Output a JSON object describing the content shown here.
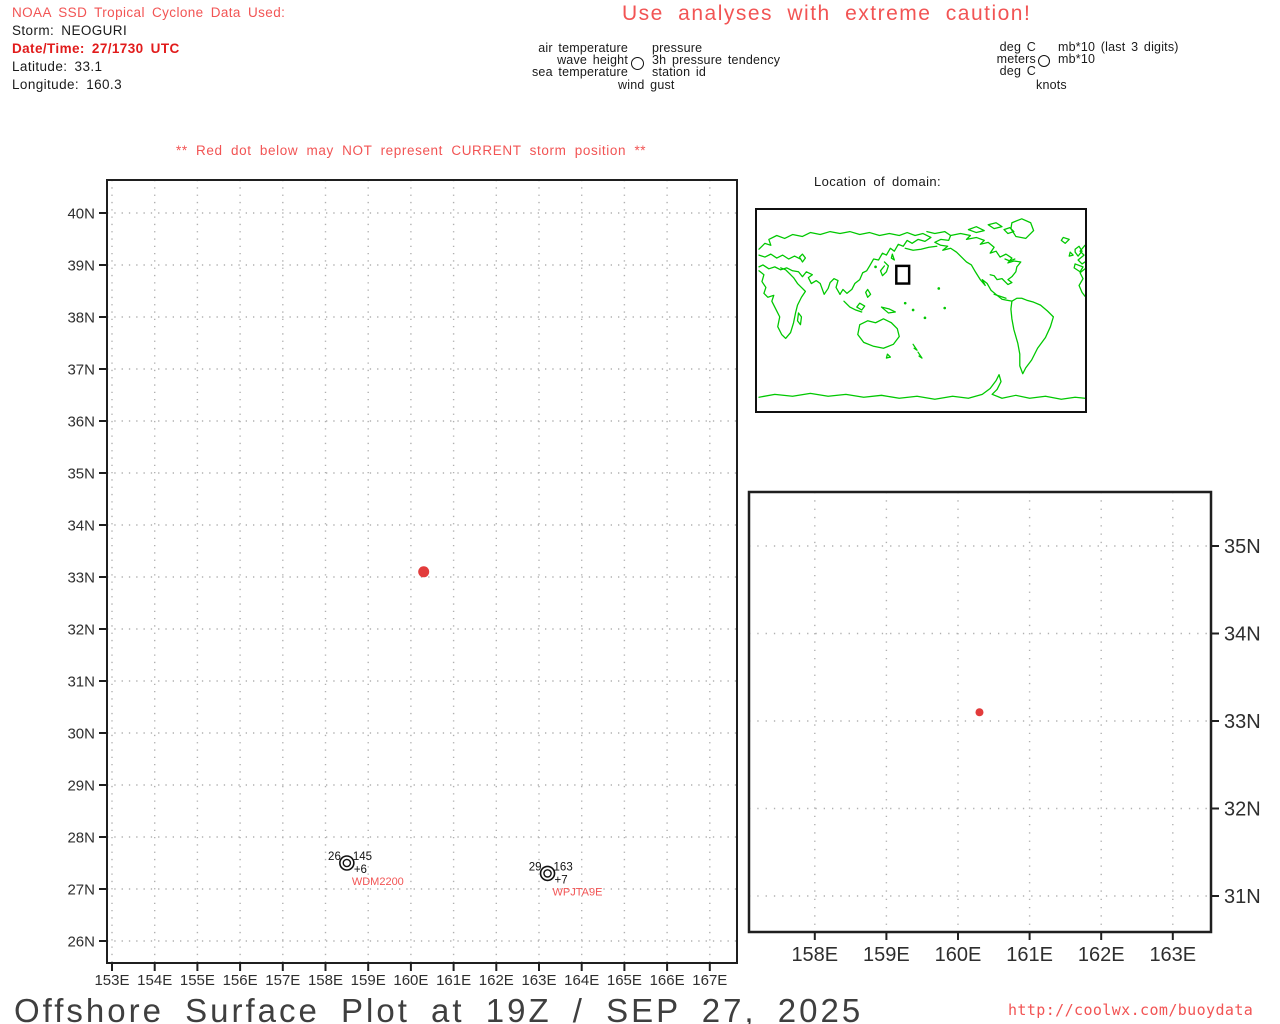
{
  "header": {
    "source_line": "NOAA SSD Tropical Cyclone Data Used:",
    "storm_line": "Storm: NEOGURI",
    "datetime_line": "Date/Time: 27/1730 UTC",
    "latitude_line": "Latitude: 33.1",
    "longitude_line": "Longitude: 160.3"
  },
  "caution_title": "Use analyses with extreme caution!",
  "legend_station_model": {
    "row1_left": "air temperature",
    "row1_right": "pressure",
    "row2_left": "wave height",
    "row2_right": "3h pressure tendency",
    "row3_left": "sea temperature",
    "row3_right": "station id",
    "row4": "wind gust"
  },
  "legend_units": {
    "row1_left": "deg C",
    "row1_right": "mb*10 (last 3 digits)",
    "row2_left": "meters",
    "row2_right": "mb*10",
    "row3_left": "deg C",
    "row4": "knots"
  },
  "warning_line": "** Red dot below may NOT represent CURRENT storm position **",
  "inset_map": {
    "title": "Location of domain:",
    "domain_box": {
      "lon_min": 153,
      "lon_max": 167,
      "lat_min": 26,
      "lat_max": 40
    }
  },
  "footer": {
    "title": "Offshore Surface Plot at 19Z / SEP 27, 2025",
    "url": "http://coolwx.com/buoydata"
  },
  "colors": {
    "red_soft": "#f25454",
    "red_bold": "#e11b1b",
    "storm_dot": "#e23b3b",
    "map_green": "#00c800",
    "grid_gray": "#b0b0b0",
    "frame_dark": "#1f1f1f",
    "label_gray": "#2e2e2e",
    "title_gray": "#3f3f3f"
  },
  "chart_data": [
    {
      "type": "scatter",
      "name": "main-surface-plot",
      "grid": "dotted, 1-degree spacing",
      "xlim": [
        152.9,
        167.7
      ],
      "ylim": [
        25.6,
        40.65
      ],
      "lon_ticks": {
        "values": [
          153,
          154,
          155,
          156,
          157,
          158,
          159,
          160,
          161,
          162,
          163,
          164,
          165,
          166,
          167
        ],
        "labels": [
          "153E",
          "154E",
          "155E",
          "156E",
          "157E",
          "158E",
          "159E",
          "160E",
          "161E",
          "162E",
          "163E",
          "164E",
          "165E",
          "166E",
          "167E"
        ]
      },
      "lat_ticks": {
        "values": [
          40,
          39,
          38,
          37,
          36,
          35,
          34,
          33,
          32,
          31,
          30,
          29,
          28,
          27,
          26
        ],
        "labels": [
          "40N",
          "39N",
          "38N",
          "37N",
          "36N",
          "35N",
          "34N",
          "33N",
          "32N",
          "31N",
          "30N",
          "29N",
          "28N",
          "27N",
          "26N"
        ]
      },
      "storm_position": {
        "lon": 160.3,
        "lat": 33.1
      },
      "stations": [
        {
          "id": "WDM2200",
          "lon": 158.5,
          "lat": 27.5,
          "air_temp": "26",
          "pressure": "145",
          "tendency": "+6"
        },
        {
          "id": "WPJTA9E",
          "lon": 163.2,
          "lat": 27.3,
          "air_temp": "29",
          "pressure": "163",
          "tendency": "+7"
        }
      ]
    },
    {
      "type": "scatter",
      "name": "zoomed-domain-plot",
      "grid": "dotted, 1-degree spacing",
      "xlim": [
        157.0,
        163.55
      ],
      "ylim": [
        30.7,
        35.6
      ],
      "lon_ticks": {
        "values": [
          158,
          159,
          160,
          161,
          162,
          163
        ],
        "labels": [
          "158E",
          "159E",
          "160E",
          "161E",
          "162E",
          "163E"
        ]
      },
      "lat_ticks": {
        "values": [
          35,
          34,
          33,
          32,
          31
        ],
        "labels": [
          "35N",
          "34N",
          "33N",
          "32N",
          "31N"
        ]
      },
      "storm_position": {
        "lon": 160.3,
        "lat": 33.1
      },
      "stations": []
    }
  ]
}
